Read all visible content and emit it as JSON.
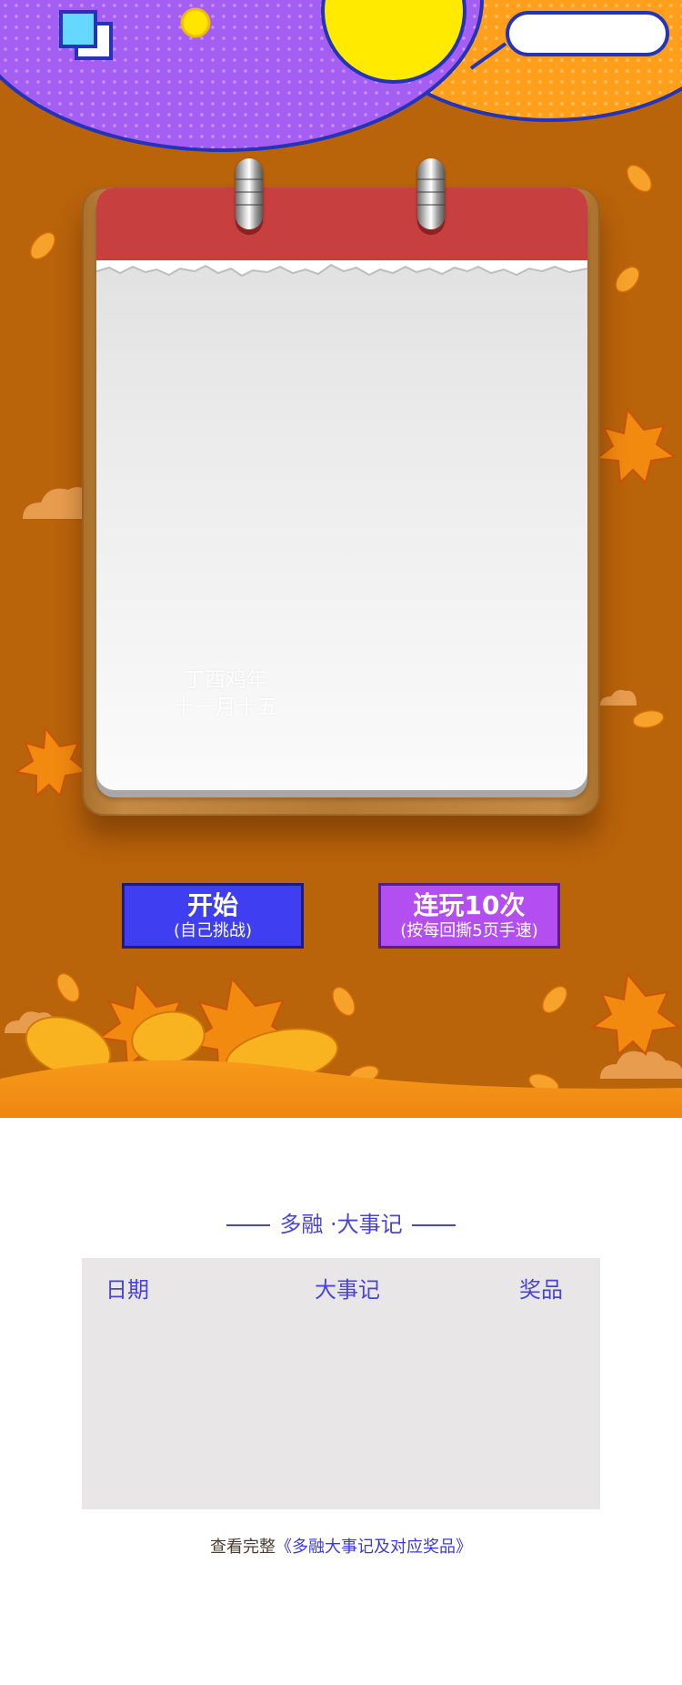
{
  "calendar": {
    "lunar_year": "丁酉鸡年",
    "lunar_date": "十一月十五"
  },
  "buttons": {
    "start_label": "开始",
    "start_sub": "(自己挑战)",
    "ten_label": "连玩10次",
    "ten_sub": "(按每回撕5页手速)"
  },
  "events": {
    "title": "多融 ·大事记",
    "columns": [
      "日期",
      "大事记",
      "奖品"
    ],
    "link_prefix": "查看完整",
    "link_text": "《多融大事记及对应奖品》"
  },
  "colors": {
    "background_brown": "#b9630b",
    "calendar_red": "#c83f3f",
    "start_button": "#3f3ff1",
    "ten_button": "#b34ff0",
    "accent_blue": "#4a44d6"
  }
}
